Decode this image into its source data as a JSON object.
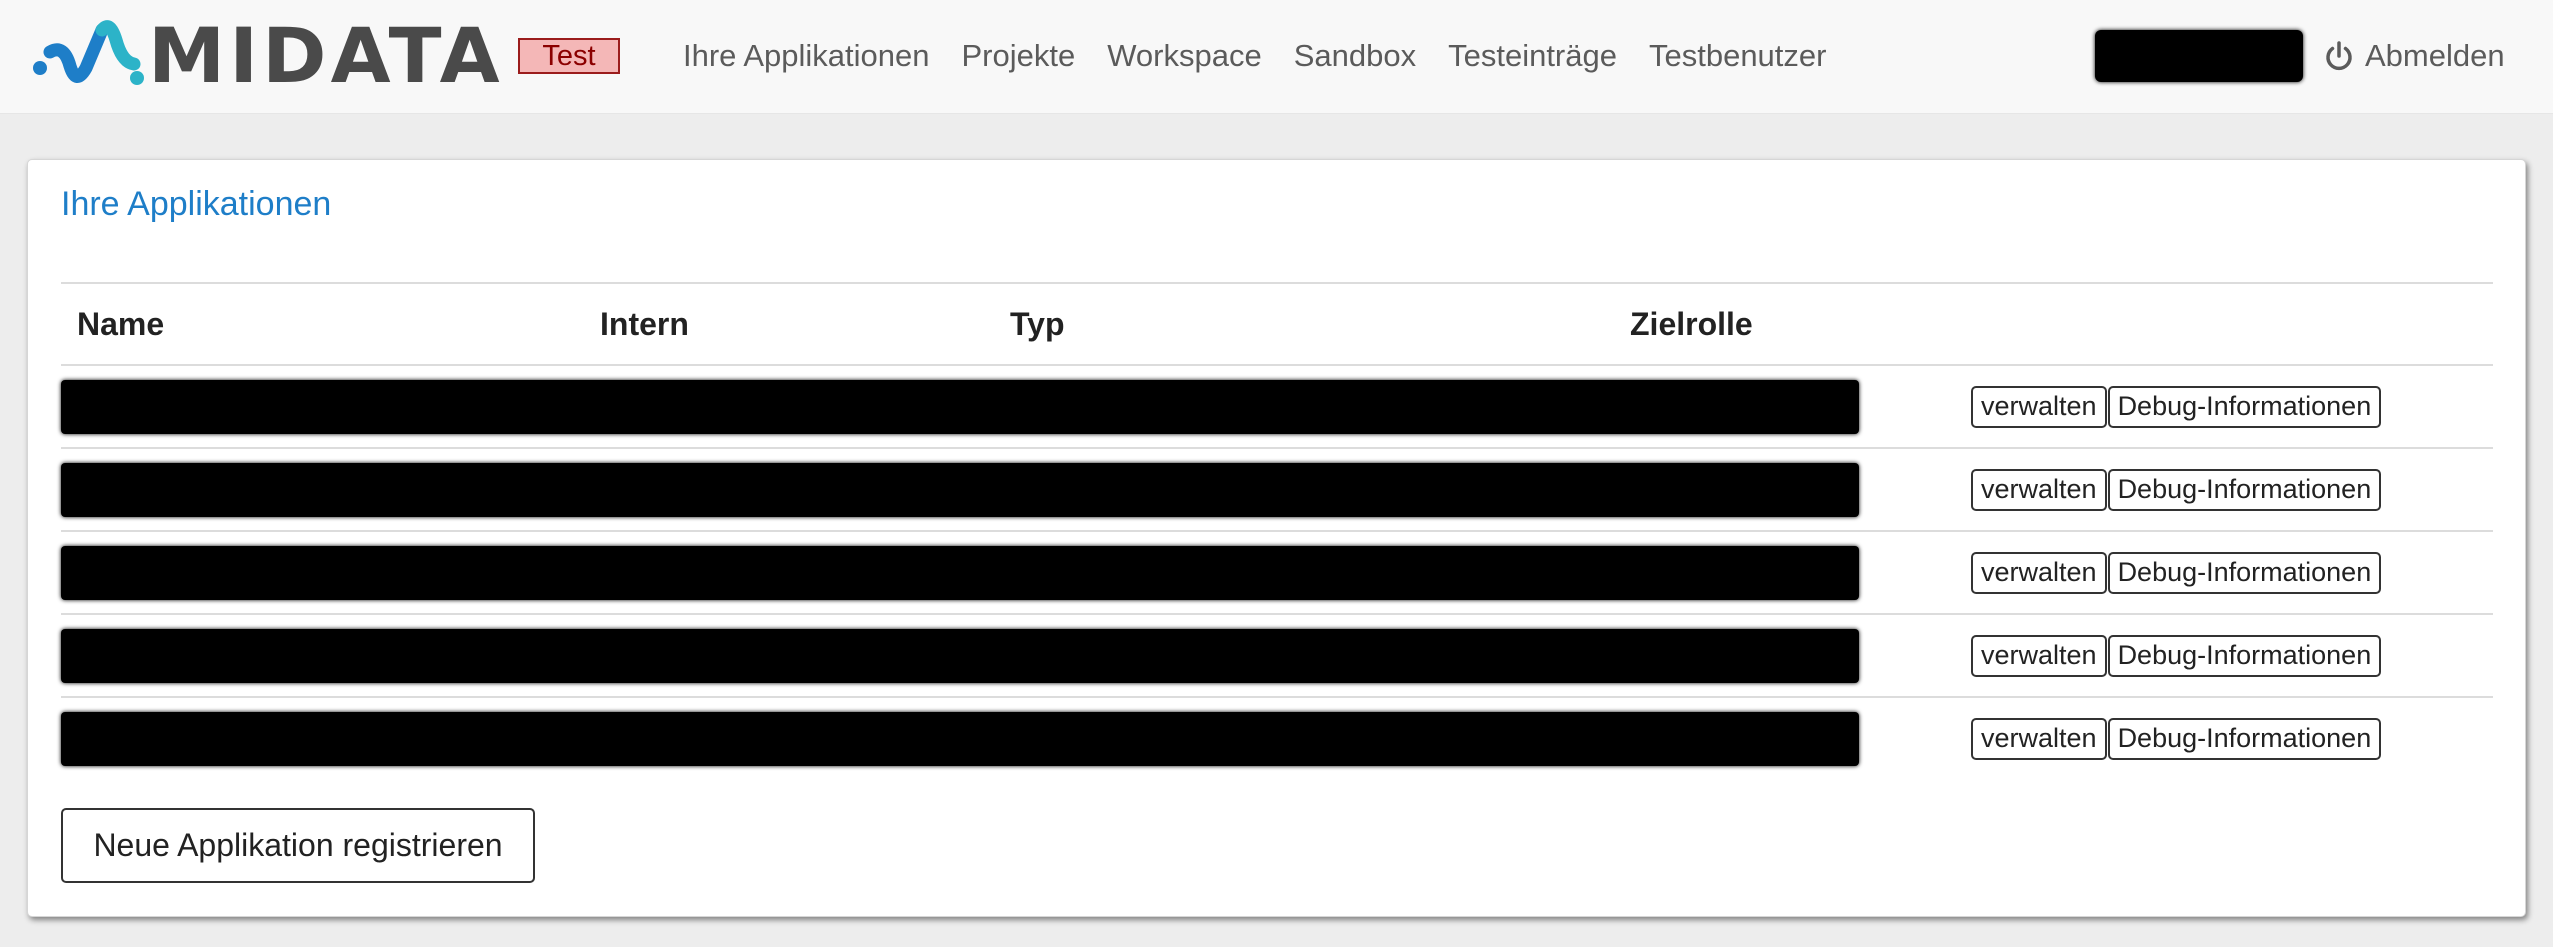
{
  "brand": {
    "name": "MIDATA",
    "logo_icon": "midata-logo-icon",
    "env_badge": "Test",
    "colors": {
      "logo_blue": "#1e7ec8",
      "logo_teal": "#2cb3c8",
      "badge_bg": "#f4b7b7",
      "badge_border": "#9b1c1c"
    }
  },
  "nav": {
    "items": [
      {
        "label": "Ihre Applikationen"
      },
      {
        "label": "Projekte"
      },
      {
        "label": "Workspace"
      },
      {
        "label": "Sandbox"
      },
      {
        "label": "Testeinträge"
      },
      {
        "label": "Testbenutzer"
      }
    ],
    "logout": {
      "label": "Abmelden",
      "icon": "power-icon"
    }
  },
  "panel": {
    "title": "Ihre Applikationen",
    "title_color": "#1e7ec8",
    "table": {
      "columns": [
        "Name",
        "Intern",
        "Typ",
        "Zielrolle",
        ""
      ],
      "rows": [
        {
          "manage_label": "verwalten",
          "debug_label": "Debug-Informationen"
        },
        {
          "manage_label": "verwalten",
          "debug_label": "Debug-Informationen"
        },
        {
          "manage_label": "verwalten",
          "debug_label": "Debug-Informationen"
        },
        {
          "manage_label": "verwalten",
          "debug_label": "Debug-Informationen"
        },
        {
          "manage_label": "verwalten",
          "debug_label": "Debug-Informationen"
        }
      ]
    },
    "register_button": "Neue Applikation registrieren"
  }
}
